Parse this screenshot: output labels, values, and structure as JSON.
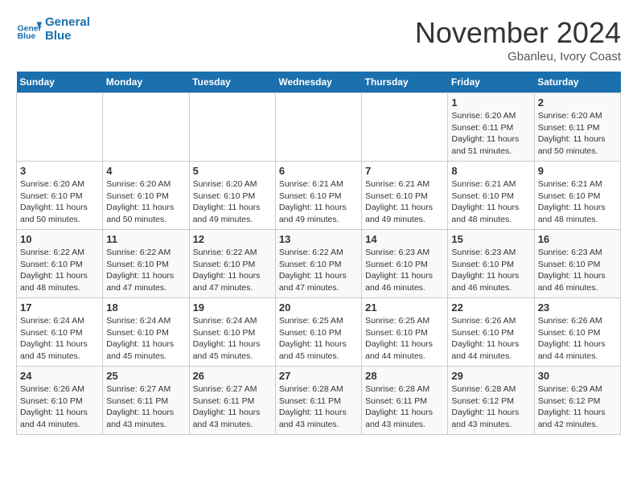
{
  "logo": {
    "line1": "General",
    "line2": "Blue"
  },
  "title": "November 2024",
  "location": "Gbanleu, Ivory Coast",
  "days_of_week": [
    "Sunday",
    "Monday",
    "Tuesday",
    "Wednesday",
    "Thursday",
    "Friday",
    "Saturday"
  ],
  "weeks": [
    [
      {
        "day": "",
        "info": ""
      },
      {
        "day": "",
        "info": ""
      },
      {
        "day": "",
        "info": ""
      },
      {
        "day": "",
        "info": ""
      },
      {
        "day": "",
        "info": ""
      },
      {
        "day": "1",
        "info": "Sunrise: 6:20 AM\nSunset: 6:11 PM\nDaylight: 11 hours and 51 minutes."
      },
      {
        "day": "2",
        "info": "Sunrise: 6:20 AM\nSunset: 6:11 PM\nDaylight: 11 hours and 50 minutes."
      }
    ],
    [
      {
        "day": "3",
        "info": "Sunrise: 6:20 AM\nSunset: 6:10 PM\nDaylight: 11 hours and 50 minutes."
      },
      {
        "day": "4",
        "info": "Sunrise: 6:20 AM\nSunset: 6:10 PM\nDaylight: 11 hours and 50 minutes."
      },
      {
        "day": "5",
        "info": "Sunrise: 6:20 AM\nSunset: 6:10 PM\nDaylight: 11 hours and 49 minutes."
      },
      {
        "day": "6",
        "info": "Sunrise: 6:21 AM\nSunset: 6:10 PM\nDaylight: 11 hours and 49 minutes."
      },
      {
        "day": "7",
        "info": "Sunrise: 6:21 AM\nSunset: 6:10 PM\nDaylight: 11 hours and 49 minutes."
      },
      {
        "day": "8",
        "info": "Sunrise: 6:21 AM\nSunset: 6:10 PM\nDaylight: 11 hours and 48 minutes."
      },
      {
        "day": "9",
        "info": "Sunrise: 6:21 AM\nSunset: 6:10 PM\nDaylight: 11 hours and 48 minutes."
      }
    ],
    [
      {
        "day": "10",
        "info": "Sunrise: 6:22 AM\nSunset: 6:10 PM\nDaylight: 11 hours and 48 minutes."
      },
      {
        "day": "11",
        "info": "Sunrise: 6:22 AM\nSunset: 6:10 PM\nDaylight: 11 hours and 47 minutes."
      },
      {
        "day": "12",
        "info": "Sunrise: 6:22 AM\nSunset: 6:10 PM\nDaylight: 11 hours and 47 minutes."
      },
      {
        "day": "13",
        "info": "Sunrise: 6:22 AM\nSunset: 6:10 PM\nDaylight: 11 hours and 47 minutes."
      },
      {
        "day": "14",
        "info": "Sunrise: 6:23 AM\nSunset: 6:10 PM\nDaylight: 11 hours and 46 minutes."
      },
      {
        "day": "15",
        "info": "Sunrise: 6:23 AM\nSunset: 6:10 PM\nDaylight: 11 hours and 46 minutes."
      },
      {
        "day": "16",
        "info": "Sunrise: 6:23 AM\nSunset: 6:10 PM\nDaylight: 11 hours and 46 minutes."
      }
    ],
    [
      {
        "day": "17",
        "info": "Sunrise: 6:24 AM\nSunset: 6:10 PM\nDaylight: 11 hours and 45 minutes."
      },
      {
        "day": "18",
        "info": "Sunrise: 6:24 AM\nSunset: 6:10 PM\nDaylight: 11 hours and 45 minutes."
      },
      {
        "day": "19",
        "info": "Sunrise: 6:24 AM\nSunset: 6:10 PM\nDaylight: 11 hours and 45 minutes."
      },
      {
        "day": "20",
        "info": "Sunrise: 6:25 AM\nSunset: 6:10 PM\nDaylight: 11 hours and 45 minutes."
      },
      {
        "day": "21",
        "info": "Sunrise: 6:25 AM\nSunset: 6:10 PM\nDaylight: 11 hours and 44 minutes."
      },
      {
        "day": "22",
        "info": "Sunrise: 6:26 AM\nSunset: 6:10 PM\nDaylight: 11 hours and 44 minutes."
      },
      {
        "day": "23",
        "info": "Sunrise: 6:26 AM\nSunset: 6:10 PM\nDaylight: 11 hours and 44 minutes."
      }
    ],
    [
      {
        "day": "24",
        "info": "Sunrise: 6:26 AM\nSunset: 6:10 PM\nDaylight: 11 hours and 44 minutes."
      },
      {
        "day": "25",
        "info": "Sunrise: 6:27 AM\nSunset: 6:11 PM\nDaylight: 11 hours and 43 minutes."
      },
      {
        "day": "26",
        "info": "Sunrise: 6:27 AM\nSunset: 6:11 PM\nDaylight: 11 hours and 43 minutes."
      },
      {
        "day": "27",
        "info": "Sunrise: 6:28 AM\nSunset: 6:11 PM\nDaylight: 11 hours and 43 minutes."
      },
      {
        "day": "28",
        "info": "Sunrise: 6:28 AM\nSunset: 6:11 PM\nDaylight: 11 hours and 43 minutes."
      },
      {
        "day": "29",
        "info": "Sunrise: 6:28 AM\nSunset: 6:12 PM\nDaylight: 11 hours and 43 minutes."
      },
      {
        "day": "30",
        "info": "Sunrise: 6:29 AM\nSunset: 6:12 PM\nDaylight: 11 hours and 42 minutes."
      }
    ]
  ]
}
